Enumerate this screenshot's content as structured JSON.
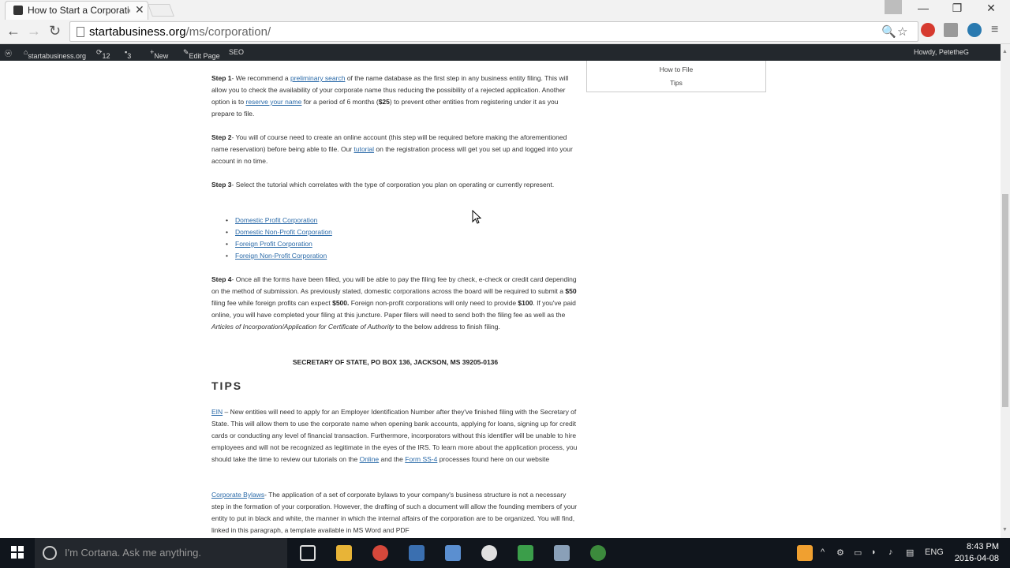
{
  "browser": {
    "tab_title": "How to Start a Corporatio",
    "url_domain": "startabusiness.org",
    "url_path": "/ms/corporation/"
  },
  "wpbar": {
    "site": "startabusiness.org",
    "updates": "12",
    "comments": "3",
    "new": "New",
    "edit": "Edit Page",
    "seo": "SEO",
    "howdy": "Howdy, PetetheG"
  },
  "sidebar": {
    "item1": "How to File",
    "item2": "Tips"
  },
  "article": {
    "step1_label": "Step 1",
    "step1_a": "- We recommend a ",
    "step1_link1": "preliminary search",
    "step1_b": " of the name database as the first step in any business entity filing. This will allow you to check the availability of your corporate name thus reducing the possibility of a rejected application. Another option is to ",
    "step1_link2": "reserve your name",
    "step1_c": " for a period of 6 months (",
    "step1_fee": "$25",
    "step1_d": ") to prevent other entities from registering under it as you prepare to file.",
    "step2_label": "Step 2",
    "step2_a": "- You will of course need to create an online account (this step will be required before making the aforementioned name reservation) before being able to file. Our ",
    "step2_link": "tutorial",
    "step2_b": " on the registration process will get you set up and logged into your account in no time.",
    "step3_label": "Step 3",
    "step3_a": "- Select the tutorial which correlates with the type of corporation you plan on operating or currently represent.",
    "links": [
      "Domestic Profit Corporation",
      "Domestic Non-Profit Corporation",
      "Foreign Profit Corporation",
      "Foreign Non-Profit Corporation"
    ],
    "step4_label": "Step 4",
    "step4_a": "- Once all the forms have been filled, you will be able to pay the filing fee by check, e-check or credit card depending on the method of submission. As previously stated, domestic corporations across the board will be required to submit a ",
    "step4_fee1": "$50",
    "step4_b": " filing fee while foreign profits can expect ",
    "step4_fee2": "$500.",
    "step4_c": " Foreign non-profit corporations will only need to provide ",
    "step4_fee3": "$100",
    "step4_d": ". If you've paid online, you will have completed your filing at this juncture. Paper filers will need to send both the filing fee as well as the ",
    "step4_italic": "Articles of Incorporation/Application for Certificate of Authority",
    "step4_e": " to the below address to finish filing.",
    "address": "SECRETARY OF STATE, PO BOX 136, JACKSON, MS 39205-0136",
    "tips_heading": "TIPS",
    "ein_link": "EIN",
    "ein_a": " – New entities will need to apply for an Employer Identification Number after they've finished filing with the Secretary of State. This will allow them to use the corporate name when opening bank accounts, applying for loans, signing up for credit cards or conducting any level of financial transaction. Furthermore, incorporators without this identifier will be unable to hire employees and will not be recognized as legitimate in the eyes of the IRS. To learn more about the application process, you should take the time to review our tutorials on the ",
    "ein_link2": "Online",
    "ein_b": " and the ",
    "ein_link3": "Form SS-4",
    "ein_c": " processes found here on our website",
    "bylaws_link": "Corporate Bylaws",
    "bylaws_a": "- The application of a set of corporate bylaws to your company's business structure is not a necessary step in the formation of your corporation. However, the drafting of such a document will allow the founding members of your entity to put in black and white, the manner in which the internal affairs of the corporation are to be organized. You will find, linked in this paragraph, a template available in MS Word and PDF"
  },
  "taskbar": {
    "cortana": "I'm Cortana. Ask me anything.",
    "lang": "ENG",
    "time": "8:43 PM",
    "date": "2016-04-08"
  },
  "colors": {
    "link": "#2a6aa8",
    "wpbar": "#23282d",
    "taskbar": "#10151c"
  }
}
